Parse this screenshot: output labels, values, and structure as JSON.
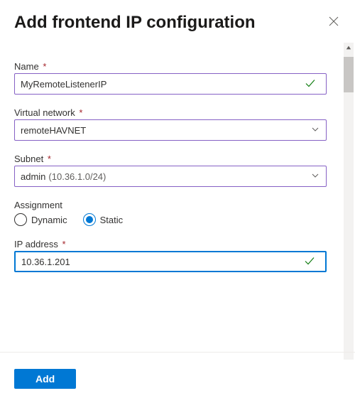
{
  "header": {
    "title": "Add frontend IP configuration"
  },
  "fields": {
    "name": {
      "label": "Name",
      "required": true,
      "value": "MyRemoteListenerIP",
      "valid": true
    },
    "vnet": {
      "label": "Virtual network",
      "required": true,
      "value": "remoteHAVNET"
    },
    "subnet": {
      "label": "Subnet",
      "required": true,
      "value": "admin",
      "suffix": "(10.36.1.0/24)"
    },
    "assignment": {
      "label": "Assignment",
      "options": {
        "dynamic": "Dynamic",
        "static": "Static"
      },
      "selected": "static"
    },
    "ip": {
      "label": "IP address",
      "required": true,
      "value": "10.36.1.201",
      "valid": true
    }
  },
  "footer": {
    "add_label": "Add"
  },
  "asterisk": "*"
}
